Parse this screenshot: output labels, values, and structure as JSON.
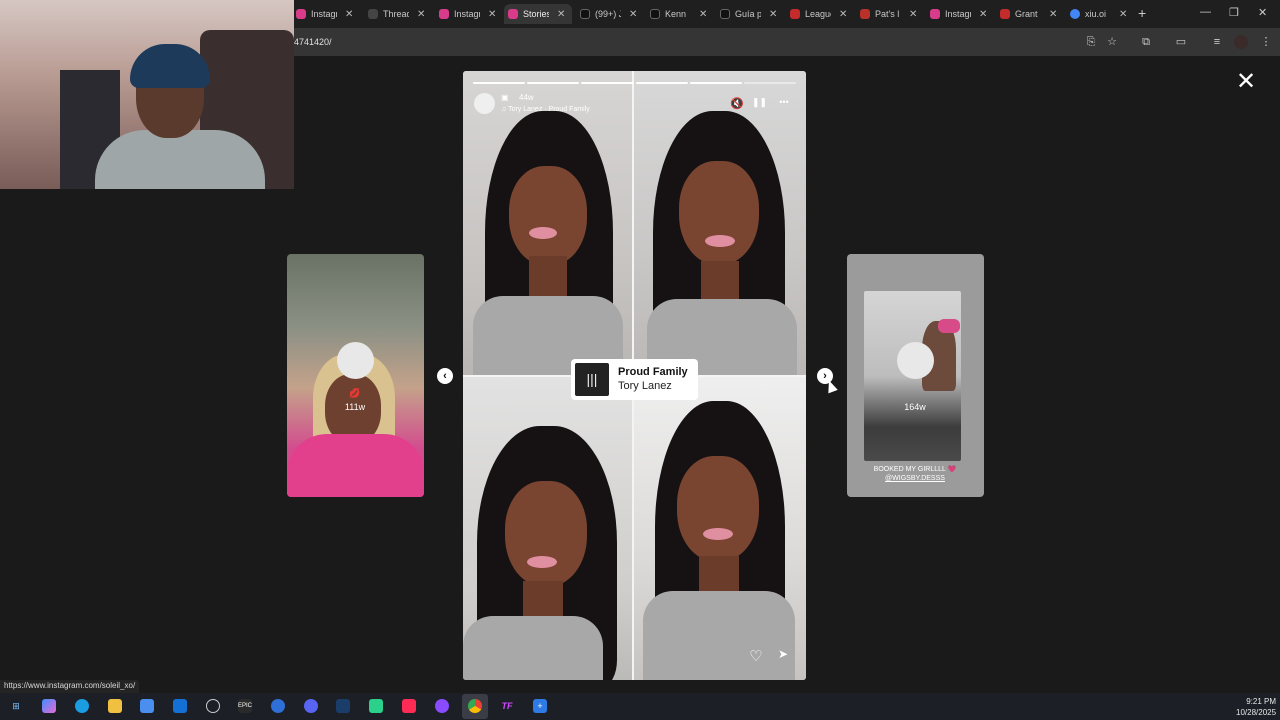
{
  "browser": {
    "tabs": [
      {
        "title": "Instagram",
        "color": "#d83b8a",
        "active": false
      },
      {
        "title": "Threads",
        "color": "#444444",
        "active": false
      },
      {
        "title": "Instagram",
        "color": "#d83b8a",
        "active": false
      },
      {
        "title": "Stories",
        "color": "#d83b8a",
        "active": true
      },
      {
        "title": "(99+) Js",
        "color": "#111111",
        "active": false
      },
      {
        "title": "Kenn",
        "color": "#111111",
        "active": false
      },
      {
        "title": "Guía p",
        "color": "#111111",
        "active": false
      },
      {
        "title": "League",
        "color": "#c42b2b",
        "active": false
      },
      {
        "title": "Pat's l",
        "color": "#b8322a",
        "active": false
      },
      {
        "title": "Instagram",
        "color": "#d83b8a",
        "active": false
      },
      {
        "title": "Grant",
        "color": "#c42b2b",
        "active": false
      },
      {
        "title": "xiu.oi",
        "color": "#4285f4",
        "active": false
      }
    ],
    "url": "4741420/",
    "status_url": "https://www.instagram.com/soleil_xo/"
  },
  "story_viewer": {
    "main": {
      "time_ago": "44w",
      "music_line": "Tory Lanez · Proud Family",
      "progress_segments": 6,
      "progress_done": 5,
      "music_sticker": {
        "title": "Proud Family",
        "artist": "Tory Lanez"
      }
    },
    "prev": {
      "time_ago": "111w",
      "emoji": "💋"
    },
    "next": {
      "time_ago": "164w",
      "caption": "BOOKED MY GIRLLLL 💗",
      "caption_mention": "@WIGSBY.DESSS"
    }
  },
  "icons": {
    "close": "✕",
    "mute": "🔇",
    "pause": "❚❚",
    "more": "•••",
    "prev": "‹",
    "next": "›",
    "like": "♡",
    "share": "➤"
  },
  "taskbar": {
    "apps": [
      "start",
      "copilot",
      "edge",
      "files",
      "store",
      "outlook",
      "obs",
      "epic",
      "app",
      "discord",
      "steam",
      "game",
      "tiktok",
      "podcast",
      "chrome",
      "tf",
      "plus"
    ],
    "time": "9:21 PM",
    "date": "10/28/2025"
  }
}
